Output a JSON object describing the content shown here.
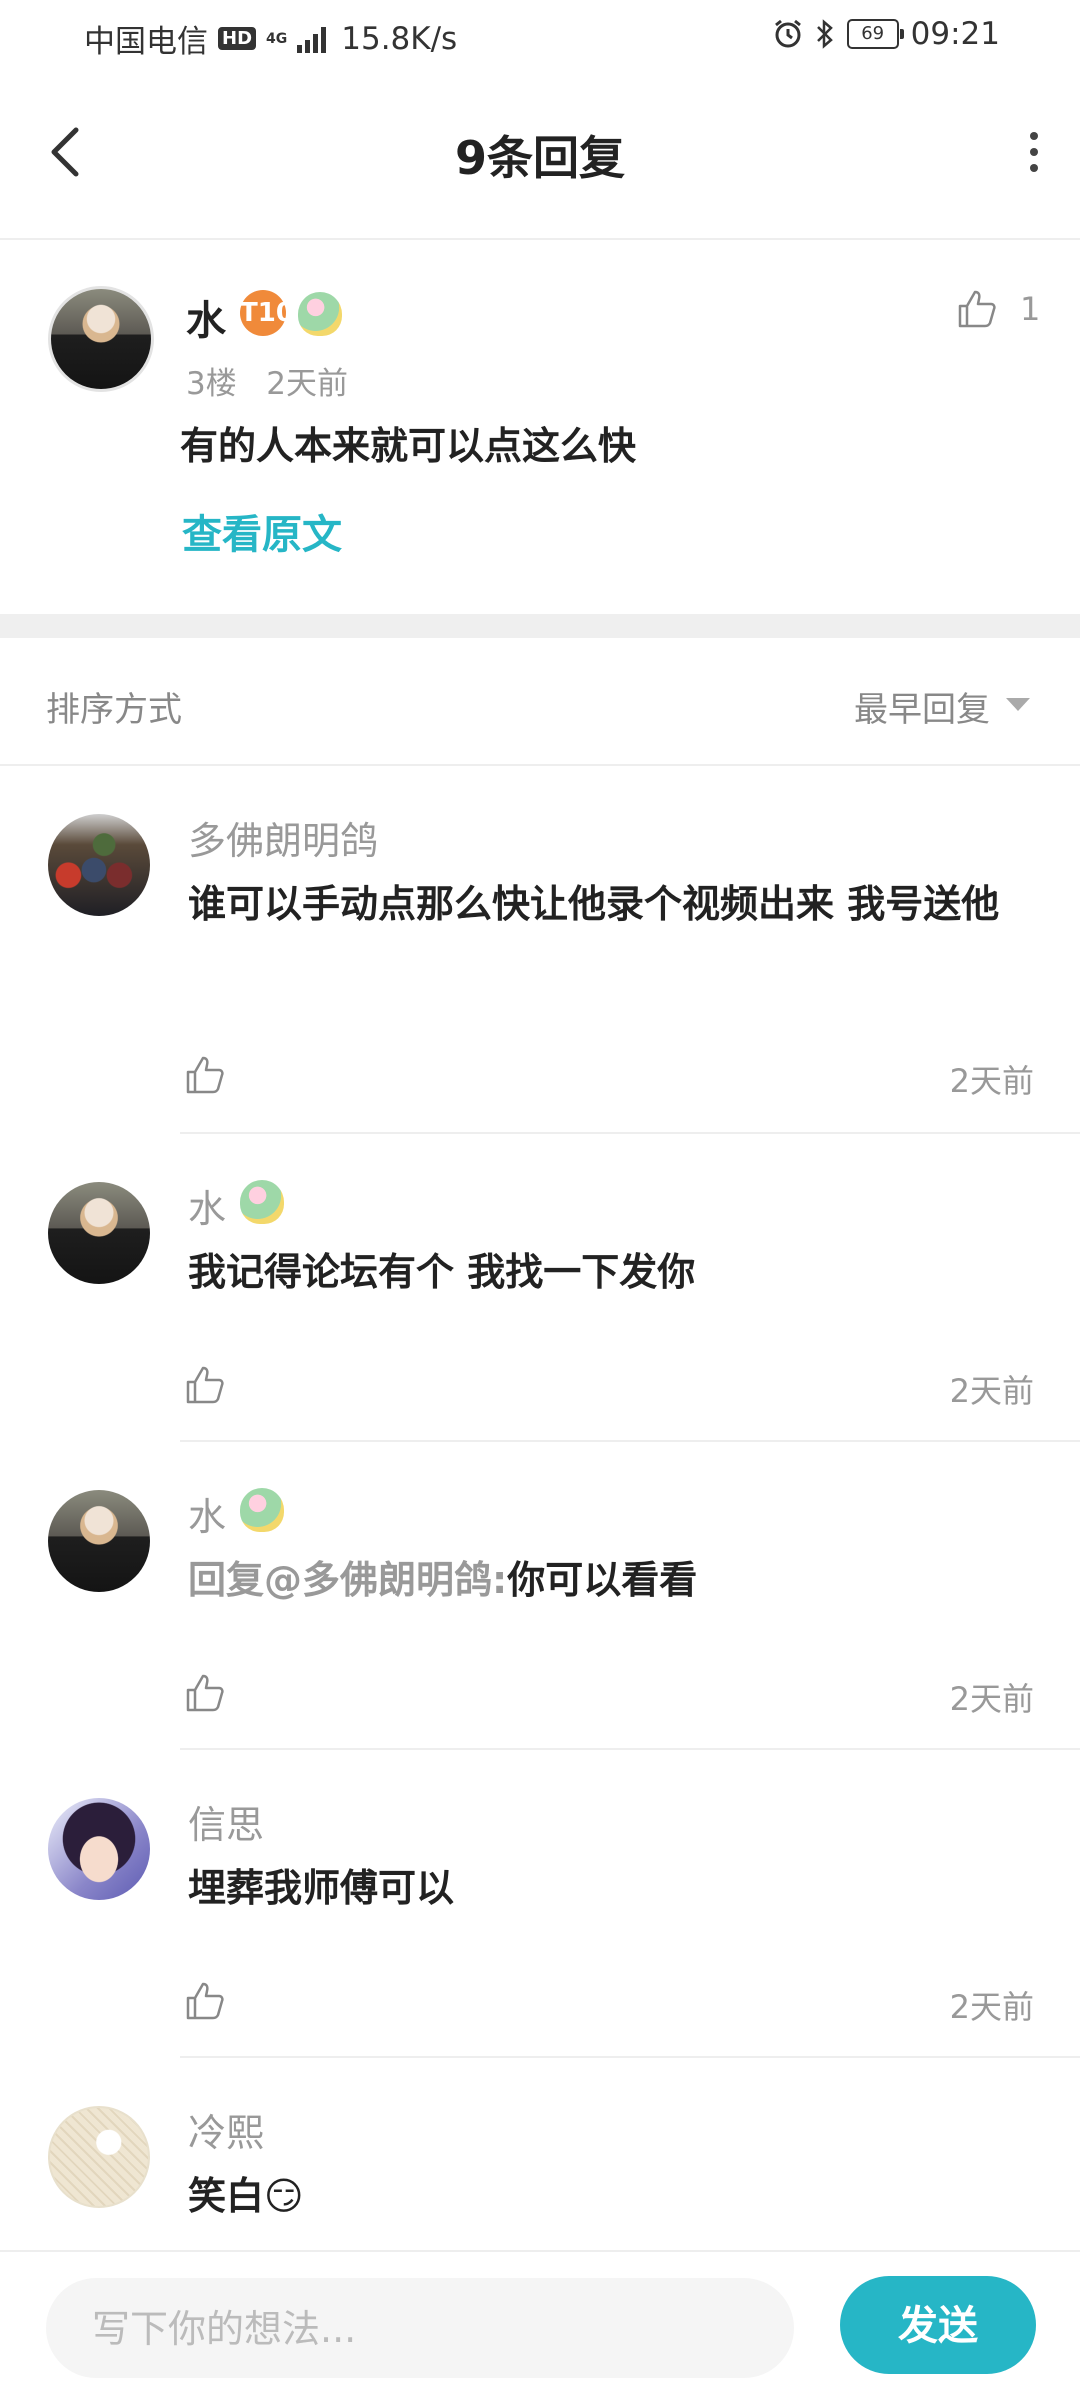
{
  "status_bar": {
    "carrier": "中国电信",
    "hd": "HD",
    "network": "4G",
    "speed": "15.8K/s",
    "battery": "69",
    "time": "09:21",
    "icons": [
      "signal-icon",
      "alarm-icon",
      "bluetooth-icon",
      "battery-icon"
    ]
  },
  "header": {
    "title": "9条回复",
    "back_icon": "back-arrow-icon",
    "more_icon": "more-vertical-icon"
  },
  "main_comment": {
    "user": "水",
    "level_badge": "T10",
    "floor": "3楼",
    "time": "2天前",
    "likes": "1",
    "text": "有的人本来就可以点这么快",
    "view_original": "查看原文"
  },
  "sort": {
    "label": "排序方式",
    "value": "最早回复"
  },
  "replies": [
    {
      "user": "多佛朗明鸽",
      "text": "谁可以手动点那么快让他录个视频出来 我号送他",
      "time": "2天前"
    },
    {
      "user": "水",
      "text": "我记得论坛有个 我找一下发你",
      "time": "2天前"
    },
    {
      "user": "水",
      "mention": "回复@多佛朗明鸽:",
      "text": "你可以看看",
      "time": "2天前"
    },
    {
      "user": "信思",
      "text": "埋葬我师傅可以",
      "time": "2天前"
    },
    {
      "user": "冷熙",
      "text": "笑白😏",
      "time": ""
    }
  ],
  "composer": {
    "placeholder": "写下你的想法...",
    "send_label": "发送"
  },
  "colors": {
    "accent": "#26b6c6",
    "muted_text": "#999999",
    "badge_orange": "#f08a3a"
  }
}
